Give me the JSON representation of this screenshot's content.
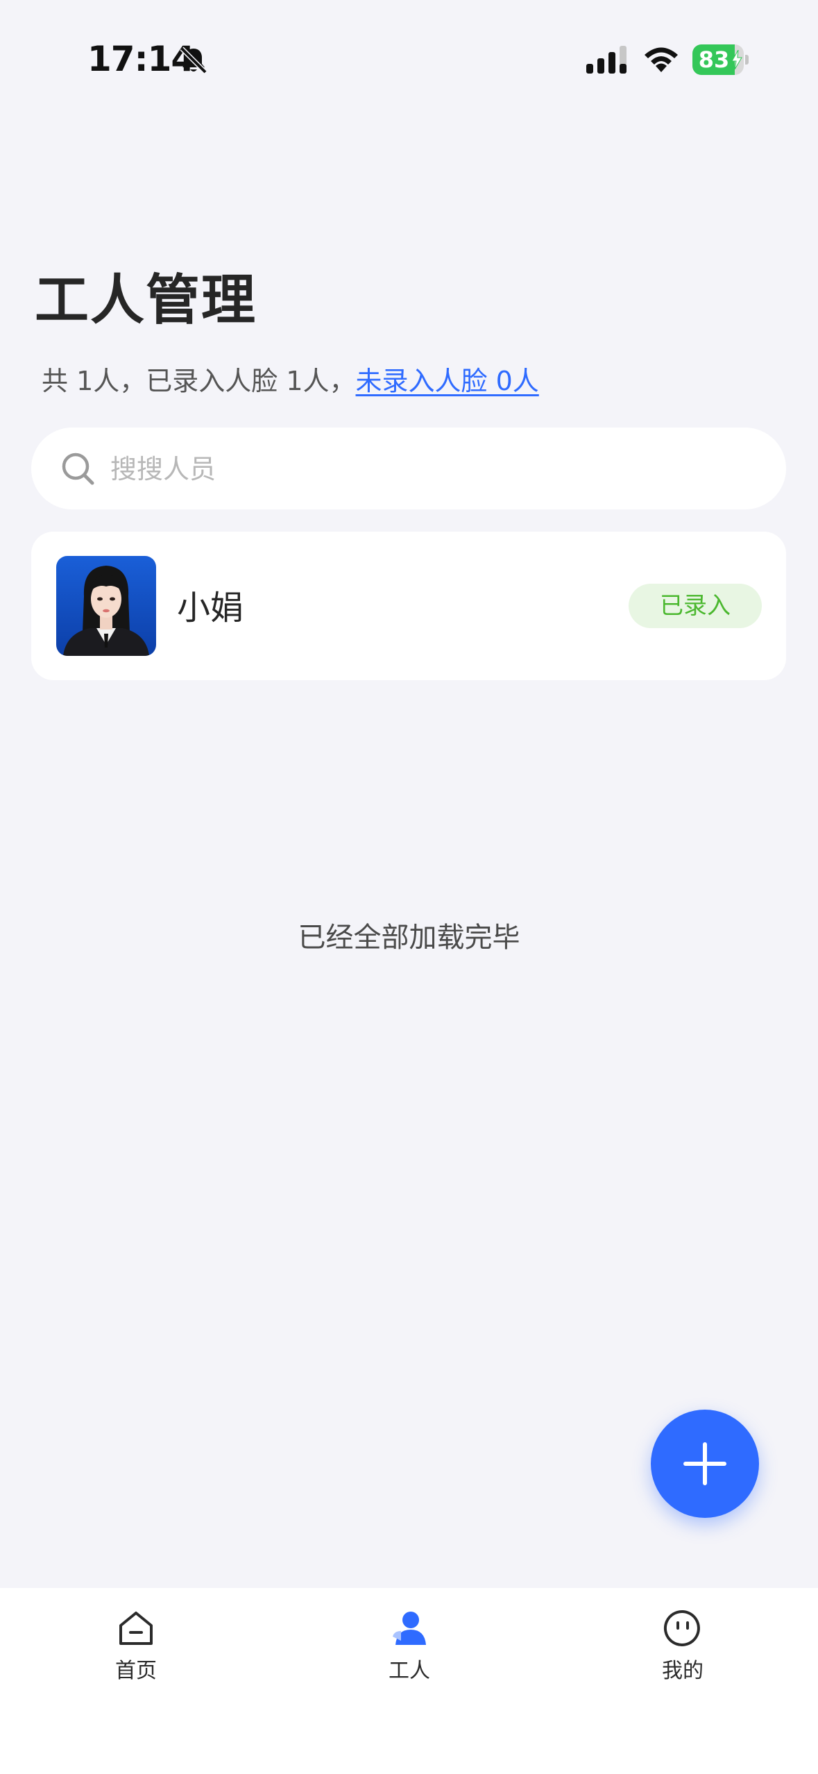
{
  "status_bar": {
    "time": "17:14",
    "battery": "83",
    "battery_level": 0.83,
    "icons": [
      "bell-slash-icon",
      "cellular-signal-icon",
      "wifi-icon",
      "battery-charging-icon"
    ]
  },
  "header": {
    "title": "工人管理",
    "summary_text": "共 1人，已录入人脸 1人，",
    "summary_link": "未录入人脸 0人"
  },
  "search": {
    "placeholder": "搜搜人员",
    "value": ""
  },
  "workers": [
    {
      "name": "小娟",
      "status": "已录入"
    }
  ],
  "list_end_text": "已经全部加载完毕",
  "fab": {
    "icon": "plus-icon"
  },
  "tab_bar": {
    "tabs": [
      {
        "label": "首页",
        "icon": "home-icon",
        "active": false
      },
      {
        "label": "工人",
        "icon": "user-icon",
        "active": true
      },
      {
        "label": "我的",
        "icon": "profile-face-icon",
        "active": false
      }
    ]
  },
  "colors": {
    "accent": "#2f6bff",
    "background": "#f4f4f9",
    "badge_bg": "#e8f6e3",
    "badge_text": "#4bb82f",
    "battery": "#34c759"
  }
}
